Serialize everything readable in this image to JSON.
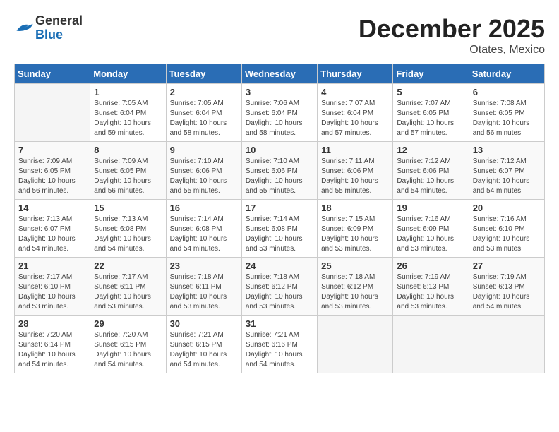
{
  "header": {
    "logo_general": "General",
    "logo_blue": "Blue",
    "month": "December 2025",
    "location": "Otates, Mexico"
  },
  "weekdays": [
    "Sunday",
    "Monday",
    "Tuesday",
    "Wednesday",
    "Thursday",
    "Friday",
    "Saturday"
  ],
  "weeks": [
    [
      {
        "day": "",
        "info": ""
      },
      {
        "day": "1",
        "info": "Sunrise: 7:05 AM\nSunset: 6:04 PM\nDaylight: 10 hours\nand 59 minutes."
      },
      {
        "day": "2",
        "info": "Sunrise: 7:05 AM\nSunset: 6:04 PM\nDaylight: 10 hours\nand 58 minutes."
      },
      {
        "day": "3",
        "info": "Sunrise: 7:06 AM\nSunset: 6:04 PM\nDaylight: 10 hours\nand 58 minutes."
      },
      {
        "day": "4",
        "info": "Sunrise: 7:07 AM\nSunset: 6:04 PM\nDaylight: 10 hours\nand 57 minutes."
      },
      {
        "day": "5",
        "info": "Sunrise: 7:07 AM\nSunset: 6:05 PM\nDaylight: 10 hours\nand 57 minutes."
      },
      {
        "day": "6",
        "info": "Sunrise: 7:08 AM\nSunset: 6:05 PM\nDaylight: 10 hours\nand 56 minutes."
      }
    ],
    [
      {
        "day": "7",
        "info": "Sunrise: 7:09 AM\nSunset: 6:05 PM\nDaylight: 10 hours\nand 56 minutes."
      },
      {
        "day": "8",
        "info": "Sunrise: 7:09 AM\nSunset: 6:05 PM\nDaylight: 10 hours\nand 56 minutes."
      },
      {
        "day": "9",
        "info": "Sunrise: 7:10 AM\nSunset: 6:06 PM\nDaylight: 10 hours\nand 55 minutes."
      },
      {
        "day": "10",
        "info": "Sunrise: 7:10 AM\nSunset: 6:06 PM\nDaylight: 10 hours\nand 55 minutes."
      },
      {
        "day": "11",
        "info": "Sunrise: 7:11 AM\nSunset: 6:06 PM\nDaylight: 10 hours\nand 55 minutes."
      },
      {
        "day": "12",
        "info": "Sunrise: 7:12 AM\nSunset: 6:06 PM\nDaylight: 10 hours\nand 54 minutes."
      },
      {
        "day": "13",
        "info": "Sunrise: 7:12 AM\nSunset: 6:07 PM\nDaylight: 10 hours\nand 54 minutes."
      }
    ],
    [
      {
        "day": "14",
        "info": "Sunrise: 7:13 AM\nSunset: 6:07 PM\nDaylight: 10 hours\nand 54 minutes."
      },
      {
        "day": "15",
        "info": "Sunrise: 7:13 AM\nSunset: 6:08 PM\nDaylight: 10 hours\nand 54 minutes."
      },
      {
        "day": "16",
        "info": "Sunrise: 7:14 AM\nSunset: 6:08 PM\nDaylight: 10 hours\nand 54 minutes."
      },
      {
        "day": "17",
        "info": "Sunrise: 7:14 AM\nSunset: 6:08 PM\nDaylight: 10 hours\nand 53 minutes."
      },
      {
        "day": "18",
        "info": "Sunrise: 7:15 AM\nSunset: 6:09 PM\nDaylight: 10 hours\nand 53 minutes."
      },
      {
        "day": "19",
        "info": "Sunrise: 7:16 AM\nSunset: 6:09 PM\nDaylight: 10 hours\nand 53 minutes."
      },
      {
        "day": "20",
        "info": "Sunrise: 7:16 AM\nSunset: 6:10 PM\nDaylight: 10 hours\nand 53 minutes."
      }
    ],
    [
      {
        "day": "21",
        "info": "Sunrise: 7:17 AM\nSunset: 6:10 PM\nDaylight: 10 hours\nand 53 minutes."
      },
      {
        "day": "22",
        "info": "Sunrise: 7:17 AM\nSunset: 6:11 PM\nDaylight: 10 hours\nand 53 minutes."
      },
      {
        "day": "23",
        "info": "Sunrise: 7:18 AM\nSunset: 6:11 PM\nDaylight: 10 hours\nand 53 minutes."
      },
      {
        "day": "24",
        "info": "Sunrise: 7:18 AM\nSunset: 6:12 PM\nDaylight: 10 hours\nand 53 minutes."
      },
      {
        "day": "25",
        "info": "Sunrise: 7:18 AM\nSunset: 6:12 PM\nDaylight: 10 hours\nand 53 minutes."
      },
      {
        "day": "26",
        "info": "Sunrise: 7:19 AM\nSunset: 6:13 PM\nDaylight: 10 hours\nand 53 minutes."
      },
      {
        "day": "27",
        "info": "Sunrise: 7:19 AM\nSunset: 6:13 PM\nDaylight: 10 hours\nand 54 minutes."
      }
    ],
    [
      {
        "day": "28",
        "info": "Sunrise: 7:20 AM\nSunset: 6:14 PM\nDaylight: 10 hours\nand 54 minutes."
      },
      {
        "day": "29",
        "info": "Sunrise: 7:20 AM\nSunset: 6:15 PM\nDaylight: 10 hours\nand 54 minutes."
      },
      {
        "day": "30",
        "info": "Sunrise: 7:21 AM\nSunset: 6:15 PM\nDaylight: 10 hours\nand 54 minutes."
      },
      {
        "day": "31",
        "info": "Sunrise: 7:21 AM\nSunset: 6:16 PM\nDaylight: 10 hours\nand 54 minutes."
      },
      {
        "day": "",
        "info": ""
      },
      {
        "day": "",
        "info": ""
      },
      {
        "day": "",
        "info": ""
      }
    ]
  ]
}
